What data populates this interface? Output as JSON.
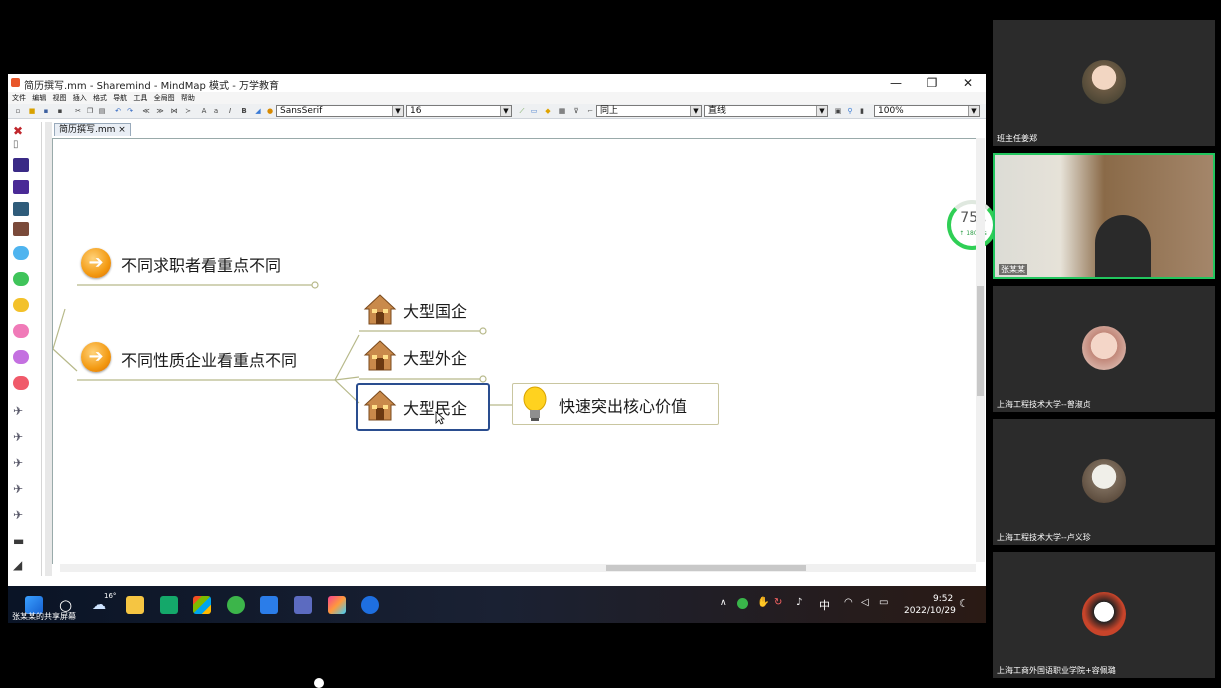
{
  "window": {
    "title": "简历撰写.mm - Sharemind - MindMap 模式 - 万学教育",
    "controls": {
      "minimize": "—",
      "maximize": "❐",
      "close": "✕"
    }
  },
  "menu": [
    "文件",
    "编辑",
    "视图",
    "插入",
    "格式",
    "导航",
    "工具",
    "全局图",
    "帮助"
  ],
  "toolbar": {
    "font_name": "SansSerif",
    "font_size": "16",
    "edge_color": "同上",
    "edge_style": "直线",
    "zoom": "100%"
  },
  "document_tab": {
    "label": "简历撰写.mm",
    "close": "×"
  },
  "mindmap": {
    "branch1": "不同求职者看重点不同",
    "branch2": "不同性质企业看重点不同",
    "children": [
      "大型国企",
      "大型外企",
      "大型民企"
    ],
    "leaf": "快速突出核心价值"
  },
  "network_gauge": {
    "percent": "75",
    "percent_unit": "%",
    "speed": "↑ 180K/s",
    "fill_fraction": 0.75
  },
  "taskbar": {
    "weather": "16°",
    "ime": "中",
    "time": "9:52",
    "date": "2022/10/29",
    "share_label": "张某某的共享屏幕"
  },
  "participants": [
    {
      "name": "班主任姜郑"
    },
    {
      "name": "张某某"
    },
    {
      "name": "上海工程技术大学--曾淑贞"
    },
    {
      "name": "上海工程技术大学--卢义珍"
    },
    {
      "name": "上海工商外国语职业学院+容佩璐"
    }
  ],
  "colors": {
    "node_line": "#b7b98a",
    "selected_border": "#2a4d8f",
    "gauge_green": "#2fcf55",
    "active_video_border": "#22c55e"
  }
}
